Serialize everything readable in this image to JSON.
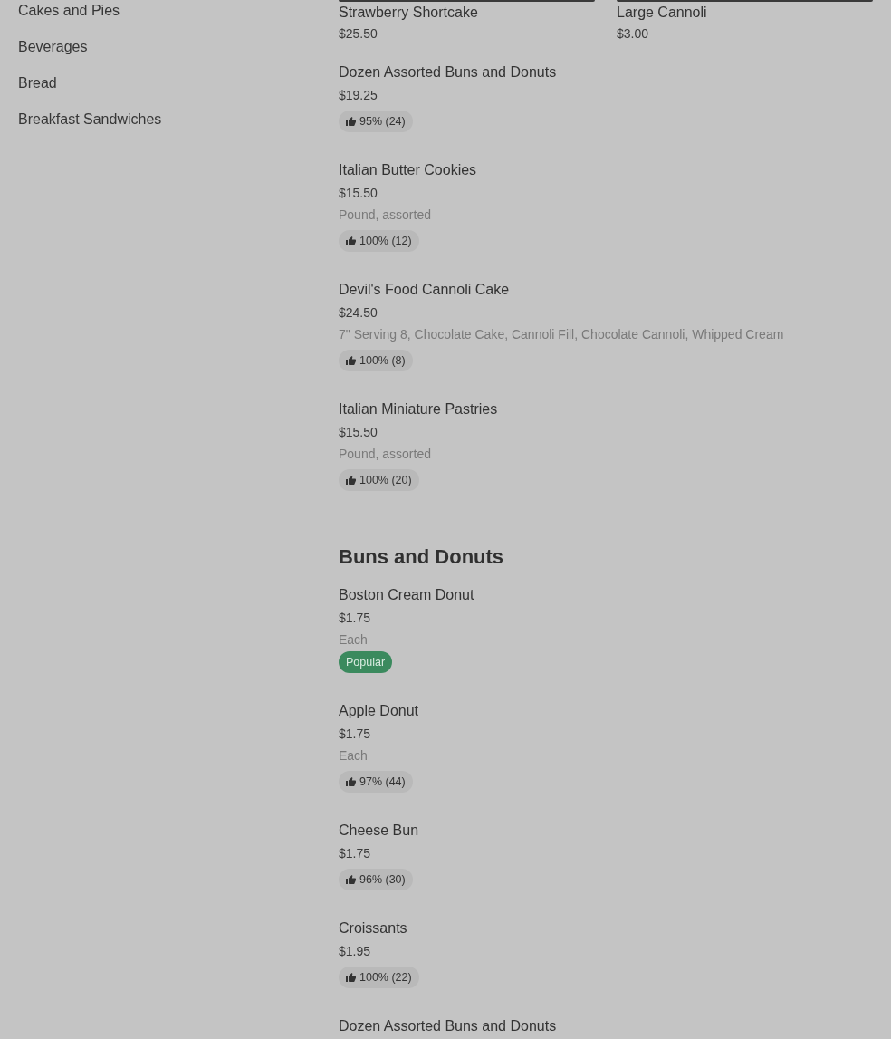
{
  "sidebar": {
    "items": [
      "Cakes and Pies",
      "Beverages",
      "Bread",
      "Breakfast Sandwiches"
    ]
  },
  "sections": [
    {
      "featured": [
        {
          "name": "Strawberry Shortcake",
          "price": "$25.50"
        },
        {
          "name": "Large Cannoli",
          "price": "$3.00"
        }
      ],
      "items": [
        {
          "name": "Dozen Assorted Buns and Donuts",
          "price": "$19.25",
          "badge": {
            "kind": "rating",
            "text": "95% (24)"
          }
        },
        {
          "name": "Italian Butter Cookies",
          "price": "$15.50",
          "description": "Pound, assorted",
          "badge": {
            "kind": "rating",
            "text": "100% (12)"
          }
        },
        {
          "name": "Devil's Food Cannoli Cake",
          "price": "$24.50",
          "description": "7\" Serving 8, Chocolate Cake, Cannoli Fill, Chocolate Cannoli, Whipped Cream",
          "badge": {
            "kind": "rating",
            "text": "100% (8)"
          }
        },
        {
          "name": "Italian Miniature Pastries",
          "price": "$15.50",
          "description": "Pound, assorted",
          "badge": {
            "kind": "rating",
            "text": "100% (20)"
          }
        }
      ]
    },
    {
      "title": "Buns and Donuts",
      "items": [
        {
          "name": "Boston Cream Donut",
          "price": "$1.75",
          "description": "Each",
          "badge": {
            "kind": "popular",
            "text": "Popular"
          }
        },
        {
          "name": "Apple Donut",
          "price": "$1.75",
          "description": "Each",
          "badge": {
            "kind": "rating",
            "text": "97% (44)"
          }
        },
        {
          "name": "Cheese Bun",
          "price": "$1.75",
          "badge": {
            "kind": "rating",
            "text": "96% (30)"
          }
        },
        {
          "name": "Croissants",
          "price": "$1.95",
          "badge": {
            "kind": "rating",
            "text": "100% (22)"
          }
        },
        {
          "name": "Dozen Assorted Buns and Donuts"
        }
      ]
    }
  ]
}
